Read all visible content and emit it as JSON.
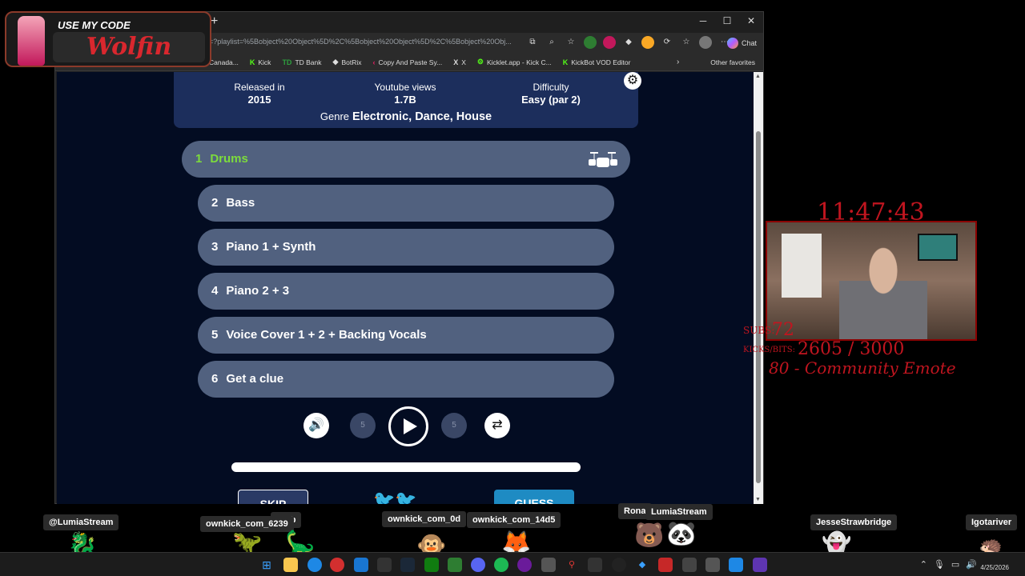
{
  "overlay": {
    "promo_code_label": "USE MY CODE",
    "promo_code_value": "Wolfin",
    "clock": "11:47:43",
    "subs_label": "SUBS:",
    "subs_value": "72",
    "kicks_label": "KICKS/BITS:",
    "kicks_value": "2605 / 3000",
    "goal_text": "80 - Community Emote"
  },
  "browser": {
    "url": "=?playlist=%5Bobject%20Object%5D%2C%5Bobject%20Object%5D%2C%5Bobject%20Obj...",
    "chat_label": "Chat",
    "bookmarks": [
      {
        "icon": "maple",
        "label": "Canada..."
      },
      {
        "icon": "K",
        "label": "Kick"
      },
      {
        "icon": "TD",
        "label": "TD Bank"
      },
      {
        "icon": "B",
        "label": "BotRix"
      },
      {
        "icon": "<",
        "label": "Copy And Paste Sy..."
      },
      {
        "icon": "X",
        "label": "X"
      },
      {
        "icon": "K",
        "label": "Kicklet.app - Kick C..."
      },
      {
        "icon": "K",
        "label": "KickBot VOD Editor"
      }
    ],
    "other_favorites": "Other favorites"
  },
  "game": {
    "released_label": "Released in",
    "released_value": "2015",
    "views_label": "Youtube views",
    "views_value": "1.7B",
    "difficulty_label": "Difficulty",
    "difficulty_value": "Easy (par 2)",
    "genre_label": "Genre",
    "genre_value": "Electronic, Dance, House",
    "tracks": [
      {
        "num": "1",
        "label": "Drums"
      },
      {
        "num": "2",
        "label": "Bass"
      },
      {
        "num": "3",
        "label": "Piano 1 + Synth"
      },
      {
        "num": "4",
        "label": "Piano 2 + 3"
      },
      {
        "num": "5",
        "label": "Voice Cover 1 + 2 + Backing Vocals"
      },
      {
        "num": "6",
        "label": "Get a clue"
      }
    ],
    "rewind_label": "5",
    "forward_label": "5",
    "skip_label": "SKIP",
    "guess_label": "GUESS"
  },
  "chat_tags": {
    "t1": "@LumiaStream",
    "t2": "ownkick_com_6239",
    "t3": "tmrb",
    "t4": "ownkick_com_0d",
    "t5": "ownkick_com_14d5",
    "t6": "Rona",
    "t7": "LumiaStream",
    "t8": "JesseStrawbridge",
    "t9": "Igotariver"
  },
  "taskbar": {
    "date": "4/25/2026"
  }
}
